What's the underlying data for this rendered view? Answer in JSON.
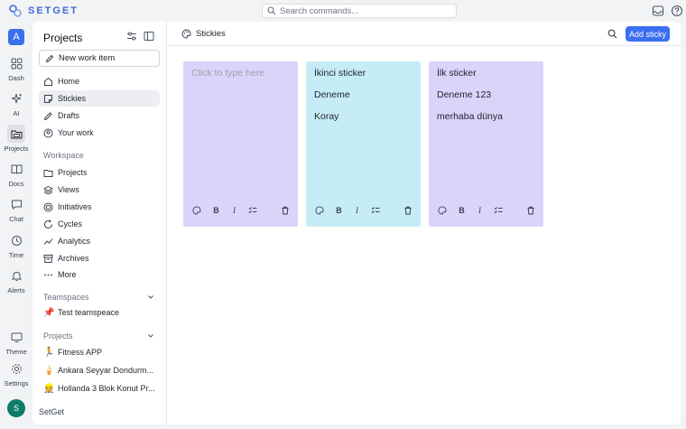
{
  "app": {
    "brand": "SETGET",
    "search_placeholder": "Search commands..."
  },
  "rail": {
    "workspace_initial": "A",
    "user_initial": "S",
    "items": [
      {
        "label": "Dash",
        "icon": "grid-icon"
      },
      {
        "label": "AI",
        "icon": "sparkle-icon"
      },
      {
        "label": "Projects",
        "icon": "folder-icon"
      },
      {
        "label": "Docs",
        "icon": "book-icon"
      },
      {
        "label": "Chat",
        "icon": "chat-icon"
      },
      {
        "label": "Time",
        "icon": "clock-icon"
      },
      {
        "label": "Alerts",
        "icon": "bell-icon"
      },
      {
        "label": "Theme",
        "icon": "monitor-icon"
      },
      {
        "label": "Settings",
        "icon": "gear-icon"
      }
    ]
  },
  "sidebar": {
    "title": "Projects",
    "new_item": "New work item",
    "nav": [
      {
        "label": "Home",
        "icon": "home-icon"
      },
      {
        "label": "Stickies",
        "icon": "sticky-icon"
      },
      {
        "label": "Drafts",
        "icon": "pencil-icon"
      },
      {
        "label": "Your work",
        "icon": "user-circle-icon"
      }
    ],
    "workspace_header": "Workspace",
    "workspace": [
      {
        "label": "Projects",
        "icon": "folder-icon"
      },
      {
        "label": "Views",
        "icon": "layers-icon"
      },
      {
        "label": "Initiatives",
        "icon": "target-icon"
      },
      {
        "label": "Cycles",
        "icon": "cycle-icon"
      },
      {
        "label": "Analytics",
        "icon": "chart-icon"
      },
      {
        "label": "Archives",
        "icon": "archive-icon"
      },
      {
        "label": "More",
        "icon": "dots-icon"
      }
    ],
    "teamspaces_header": "Teamspaces",
    "teamspaces": [
      {
        "label": "Test teamspeace",
        "emoji": "📌"
      }
    ],
    "projects_header": "Projects",
    "projects": [
      {
        "label": "Fitness APP",
        "emoji": "🏃"
      },
      {
        "label": "Ankara Seyyar Dondurm...",
        "emoji": "🍦"
      },
      {
        "label": "Hollanda 3 Blok Konut Pr...",
        "emoji": "👷"
      }
    ],
    "footer": "SetGet"
  },
  "main": {
    "breadcrumb": "Stickies",
    "add_button": "Add sticky",
    "stickies": [
      {
        "color": "#dcd3fb",
        "placeholder": "Click to type here",
        "lines": []
      },
      {
        "color": "#c6ecf6",
        "placeholder": "",
        "lines": [
          "İkinci sticker",
          "Deneme",
          "Koray"
        ]
      },
      {
        "color": "#dcd3fb",
        "placeholder": "",
        "lines": [
          "İlk sticker",
          "Deneme 123",
          "merhaba dünya"
        ]
      }
    ]
  }
}
